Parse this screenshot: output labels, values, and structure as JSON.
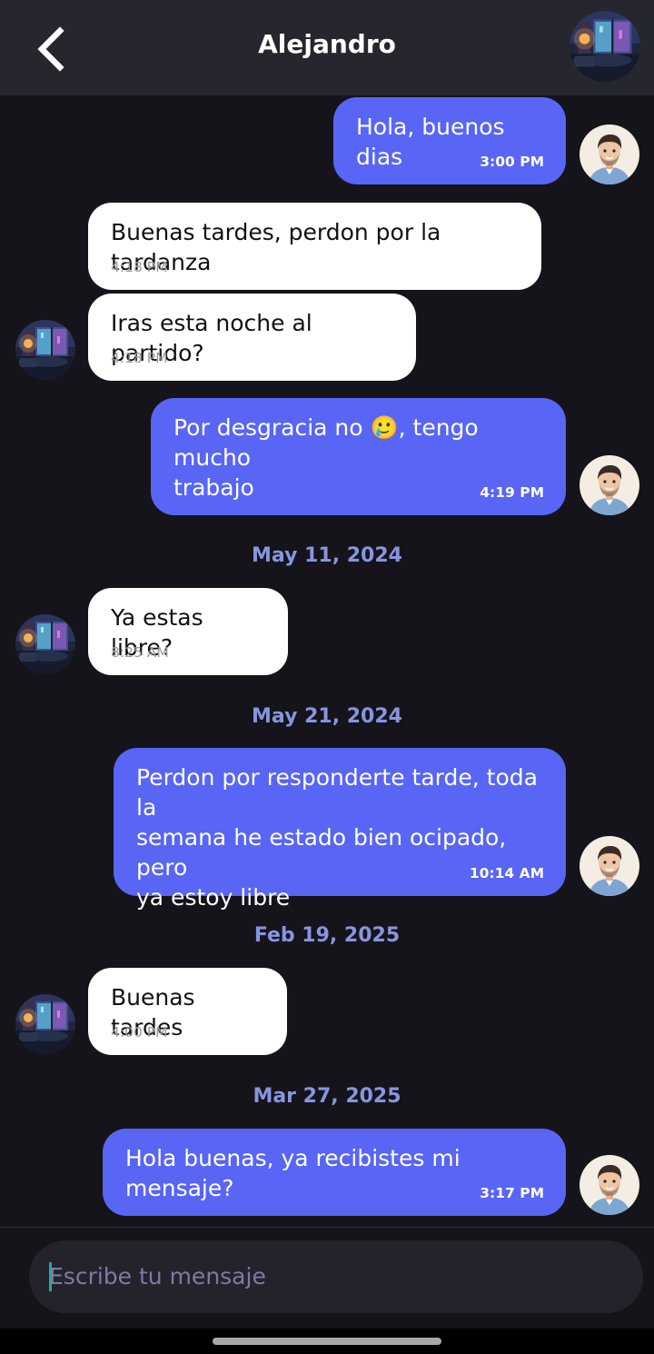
{
  "header": {
    "title": "Alejandro",
    "back_icon": "chevron-left-icon",
    "contact_avatar": "night-room-avatar"
  },
  "messages": [
    {
      "side": "sent",
      "text": "Hola, buenos dias",
      "time": "3:00 PM"
    },
    {
      "side": "recv",
      "text": "Buenas tardes, perdon por la tardanza",
      "time": "4:18 PM"
    },
    {
      "side": "recv",
      "text": "Iras esta noche al partido?",
      "time": "4:18 PM"
    },
    {
      "side": "sent",
      "text": "Por desgracia no 🥲, tengo mucho\ntrabajo",
      "time": "4:19 PM"
    },
    {
      "side": "recv",
      "text": "Ya estas libre?",
      "time": "8:25 AM"
    },
    {
      "side": "sent",
      "text": "Perdon por responderte tarde, toda la\nsemana he estado bien ocipado, pero\nya estoy libre",
      "time": "10:14 AM"
    },
    {
      "side": "recv",
      "text": "Buenas tardes",
      "time": "4:00 PM"
    },
    {
      "side": "sent",
      "text": "Hola buenas, ya recibistes mi mensaje?",
      "time": "3:17 PM"
    }
  ],
  "date_separators": [
    "May 11, 2024",
    "May 21, 2024",
    "Feb 19, 2025",
    "Mar 27, 2025"
  ],
  "input": {
    "placeholder": "Escribe tu mensaje"
  },
  "colors": {
    "background": "#15141a",
    "header": "#26262f",
    "sent_bubble": "#5865f5",
    "received_bubble": "#ffffff",
    "date_text": "#8795e0"
  }
}
